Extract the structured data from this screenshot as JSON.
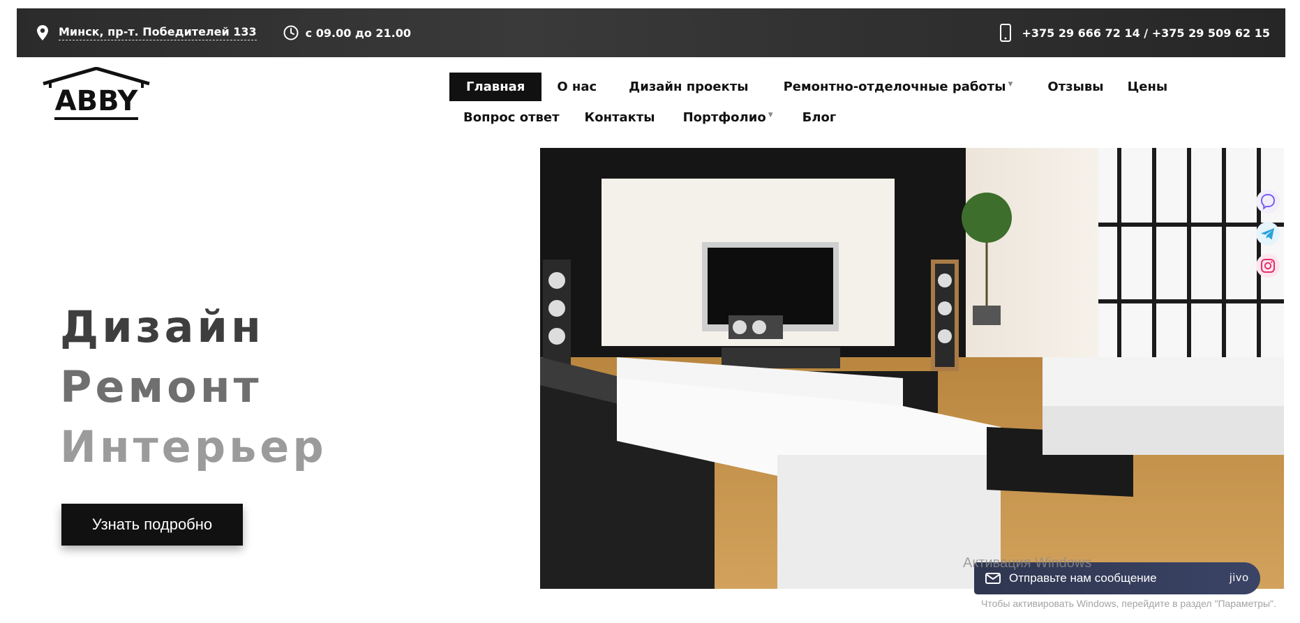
{
  "topbar": {
    "address": "Минск, пр-т. Победителей 133",
    "hours": "с 09.00 до 21.00",
    "phones": "+375 29 666 72 14 / +375 29 509 62 15"
  },
  "logo": {
    "text": "ABBY"
  },
  "nav": {
    "row1": [
      {
        "label": "Главная",
        "active": true
      },
      {
        "label": "О нас"
      },
      {
        "label": "Дизайн проекты"
      },
      {
        "label": "Ремонтно-отделочные работы",
        "dropdown": true
      },
      {
        "label": "Отзывы"
      },
      {
        "label": "Цены"
      }
    ],
    "row2": [
      {
        "label": "Вопрос ответ"
      },
      {
        "label": "Контакты"
      },
      {
        "label": "Портфолио",
        "dropdown": true
      },
      {
        "label": "Блог"
      }
    ]
  },
  "hero": {
    "line1": "Дизайн",
    "line2": "Ремонт",
    "line3": "Интерьер",
    "cta_label": "Узнать подробно"
  },
  "chat": {
    "label": "Отправьте нам сообщение",
    "brand": "jivo"
  },
  "watermark": {
    "title": "Активация Windows",
    "subtitle": "Чтобы активировать Windows, перейдите в раздел \"Параметры\"."
  },
  "colors": {
    "topbar_bg": "#2f2f2f",
    "nav_active_bg": "#111111",
    "cta_bg": "#111111",
    "chat_bg": "#353d5a",
    "viber": "#7360f2",
    "telegram": "#2aa3de",
    "instagram": "#e1306c"
  },
  "icons": {
    "address": "map-pin-icon",
    "hours": "clock-icon",
    "phone": "smartphone-icon",
    "social": [
      "viber-icon",
      "telegram-icon",
      "instagram-icon"
    ],
    "chat": "mail-icon"
  }
}
